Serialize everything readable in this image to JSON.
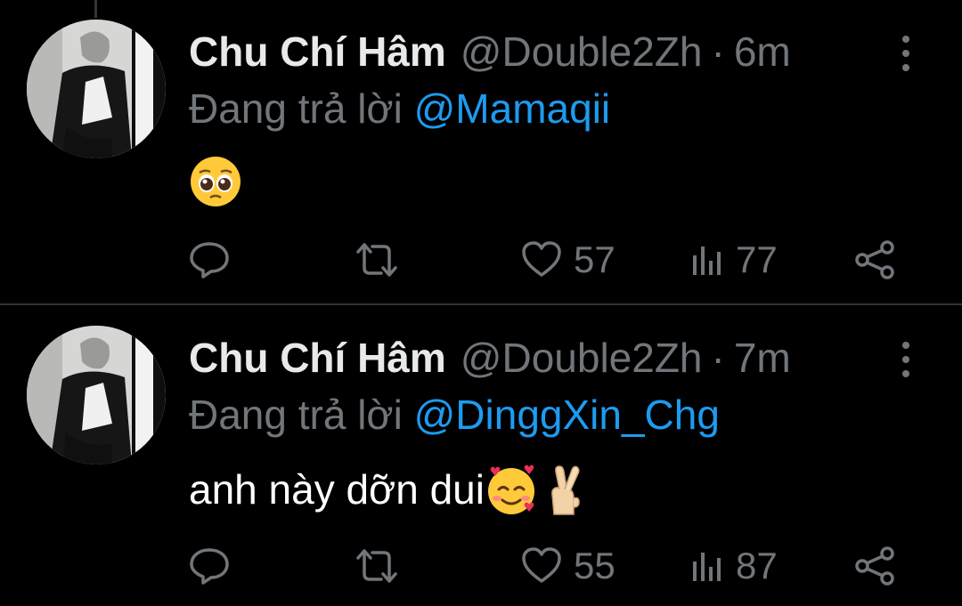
{
  "tweets": [
    {
      "display_name": "Chu Chí Hâm",
      "handle": "@Double2Zh",
      "separator": "·",
      "time": "6m",
      "reply_prefix": "Đang trả lời",
      "reply_mention": "@Mamaqii",
      "text": "",
      "emojis": [
        "pleading-face-emoji"
      ],
      "likes": "57",
      "views": "77"
    },
    {
      "display_name": "Chu Chí Hâm",
      "handle": "@Double2Zh",
      "separator": "·",
      "time": "7m",
      "reply_prefix": "Đang trả lời",
      "reply_mention": "@DinggXin_Chg",
      "text": "anh này dỡn dui",
      "emojis": [
        "smiling-face-with-hearts-emoji",
        "crossed-fingers-emoji"
      ],
      "likes": "55",
      "views": "87"
    }
  ],
  "colors": {
    "background": "#000000",
    "primary_text": "#e7e9ea",
    "secondary_text": "#71767b",
    "accent": "#1d9bf0",
    "divider": "#2f3336"
  },
  "icons": [
    "reply-icon",
    "retweet-icon",
    "like-icon",
    "views-icon",
    "share-icon",
    "more-icon"
  ]
}
